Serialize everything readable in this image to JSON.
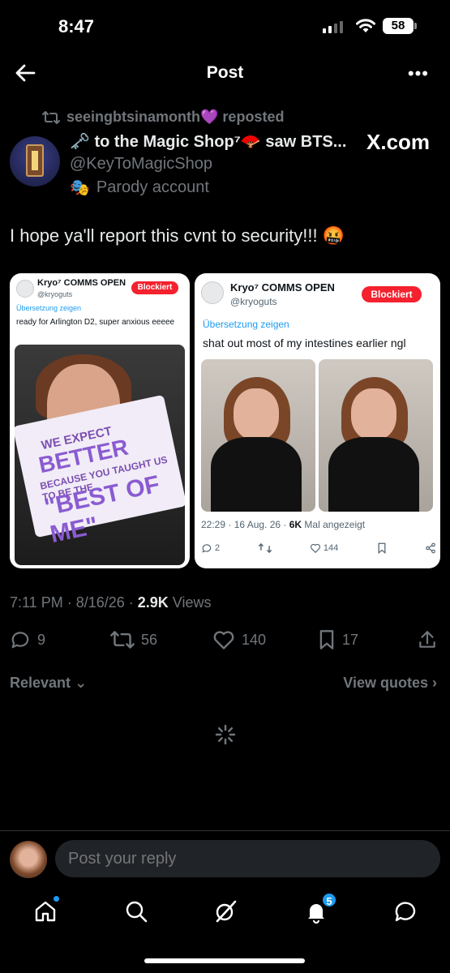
{
  "status_bar": {
    "time": "8:47",
    "battery": "58"
  },
  "header": {
    "title": "Post"
  },
  "repost": {
    "text": "seeingbtsinamonth💜 reposted"
  },
  "author": {
    "name": "🗝️ to the Magic Shop⁷🪭 saw BTS...",
    "handle": "@KeyToMagicShop",
    "label": "Parody account",
    "label_icon": "🎭",
    "source": "X.com"
  },
  "tweet": {
    "text": "I hope ya'll report this cvnt to security!!! 🤬"
  },
  "embedded_1": {
    "name": "Kryo⁷ COMMS OPEN",
    "handle": "@kryoguts",
    "badge": "Blockiert",
    "translate": "Übersetzung zeigen",
    "text": "ready for Arlington D2, super anxious eeeee",
    "sign": {
      "l1": "WE EXPECT",
      "l2": "BETTER",
      "l3": "BECAUSE YOU TAUGHT US TO BE THE",
      "l4": "\"BEST OF ME\""
    }
  },
  "embedded_2": {
    "name": "Kryo⁷ COMMS OPEN",
    "handle": "@kryoguts",
    "badge": "Blockiert",
    "translate": "Übersetzung zeigen",
    "text": "shat out most of my intestines earlier ngl",
    "meta_prefix": "22:29 · 16 Aug. 26 · ",
    "meta_views": "6K",
    "meta_suffix": " Mal angezeigt",
    "replies": "2",
    "likes": "144"
  },
  "meta": {
    "time": "7:11 PM · 8/16/26 · ",
    "views_count": "2.9K",
    "views_label": " Views"
  },
  "stats": {
    "replies": "9",
    "reposts": "56",
    "likes": "140",
    "bookmarks": "17"
  },
  "sort": {
    "label": "Relevant",
    "view_quotes": "View quotes"
  },
  "composer": {
    "placeholder": "Post your reply"
  },
  "tabbar": {
    "notifications_badge": "5"
  },
  "colors": {
    "accent": "#1d9bf0",
    "blocked": "#f4212e",
    "muted": "#71767b"
  }
}
